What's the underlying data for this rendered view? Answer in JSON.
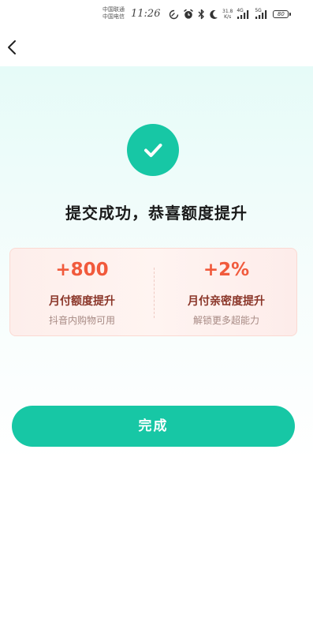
{
  "status_bar": {
    "carrier_1": "中国联通",
    "carrier_2": "中国电信",
    "time": "11:26",
    "speed_value": "31.8",
    "speed_unit": "K/s",
    "signal_1_label": "4G",
    "signal_2_label": "5G",
    "battery": "80",
    "icons": [
      "data-saver-icon",
      "alarm-icon",
      "bluetooth-icon",
      "moon-icon",
      "signal-icon",
      "signal-icon",
      "battery-icon"
    ]
  },
  "nav": {
    "back_icon": "chevron-left-icon"
  },
  "result": {
    "icon": "check-circle-icon",
    "accent_color": "#17c7a5",
    "title": "提交成功，恭喜额度提升"
  },
  "benefits": [
    {
      "value": "+800",
      "label": "月付额度提升",
      "desc": "抖音内购物可用"
    },
    {
      "value": "+2%",
      "label": "月付亲密度提升",
      "desc": "解锁更多超能力"
    }
  ],
  "highlight_color": "#f15a3c",
  "done_button": {
    "label": "完成"
  }
}
